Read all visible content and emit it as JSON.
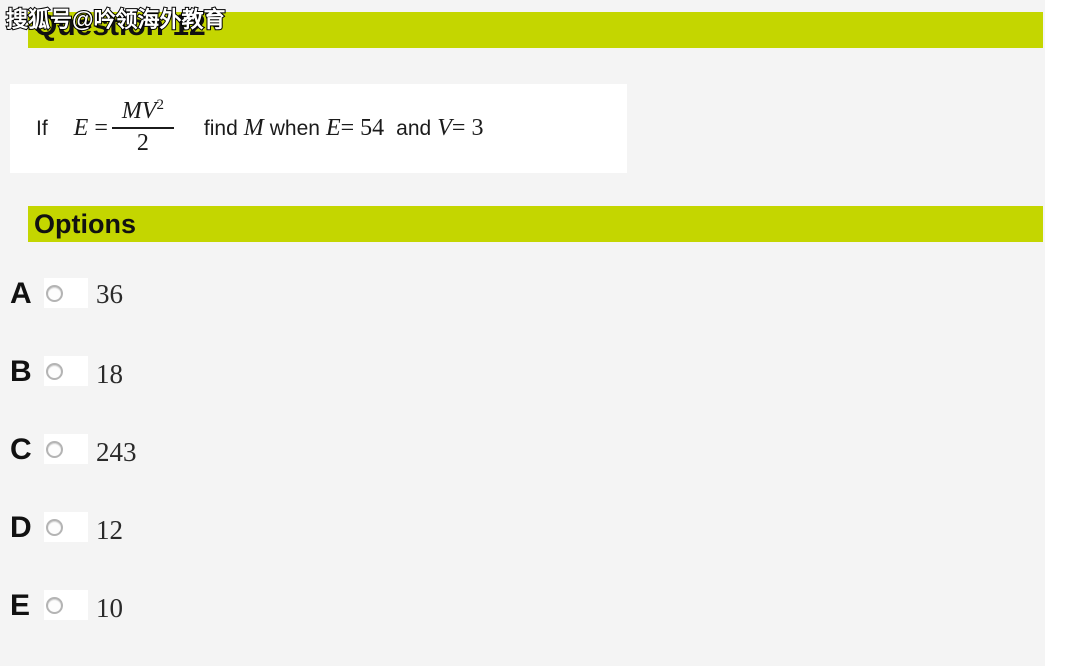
{
  "watermark": {
    "text": "搜狐号@吟领海外教育"
  },
  "question": {
    "banner_label": "Question 12",
    "equation": {
      "prefix": "If",
      "lhs": "E",
      "equals": "=",
      "fraction_numerator": "MV",
      "fraction_numerator_exponent": "2",
      "fraction_denominator": "2",
      "instruction": "find",
      "unknown": "M",
      "conjunction": "when",
      "given1_symbol": "E",
      "given1_eq": "=",
      "given1_value": "54",
      "and": "and",
      "given2_symbol": "V",
      "given2_eq": "=",
      "given2_value": "3",
      "full_text": "If E = MV²/2 find M when E = 54 and V = 3"
    }
  },
  "options": {
    "banner_label": "Options",
    "items": [
      {
        "letter": "A",
        "value": "36"
      },
      {
        "letter": "B",
        "value": "18"
      },
      {
        "letter": "C",
        "value": "243"
      },
      {
        "letter": "D",
        "value": "12"
      },
      {
        "letter": "E",
        "value": "10"
      }
    ]
  },
  "colors": {
    "banner": "#c4d600",
    "page_background": "#f4f4f4",
    "content_panel": "#ffffff",
    "text": "#111111"
  }
}
